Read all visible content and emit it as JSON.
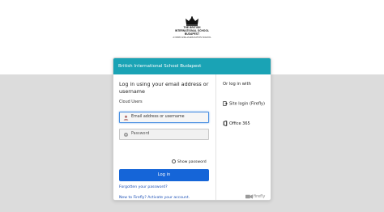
{
  "school": {
    "logo_line1": "THE BRITISH",
    "logo_line2": "INTERNATIONAL SCHOOL",
    "logo_line3": "BUDAPEST",
    "logo_tagline": "A NORD ANGLIA EDUCATION SCHOOL"
  },
  "card": {
    "header_title": "British International School Budapest"
  },
  "login": {
    "title": "Log in using your email address or username",
    "cloud_users_label": "Cloud Users",
    "username_value": "Email address or username",
    "password_placeholder": "Password",
    "show_password_label": "Show password",
    "login_button": "Log in",
    "forgot_link": "Forgotten your password?",
    "activate_link": "New to Firefly? Activate your account."
  },
  "alt_login": {
    "heading": "Or log in with",
    "options": [
      {
        "label": "Site login (Firefly)",
        "icon": "door-arrow-icon"
      },
      {
        "label": "Office 365",
        "icon": "office-icon"
      }
    ]
  },
  "footer": {
    "brand": "firefly",
    "icon": "firefly-icon"
  },
  "colors": {
    "header": "#1aa3b5",
    "button": "#1565d8",
    "link": "#1b4fb5",
    "background_lower": "#dcdcdc"
  }
}
